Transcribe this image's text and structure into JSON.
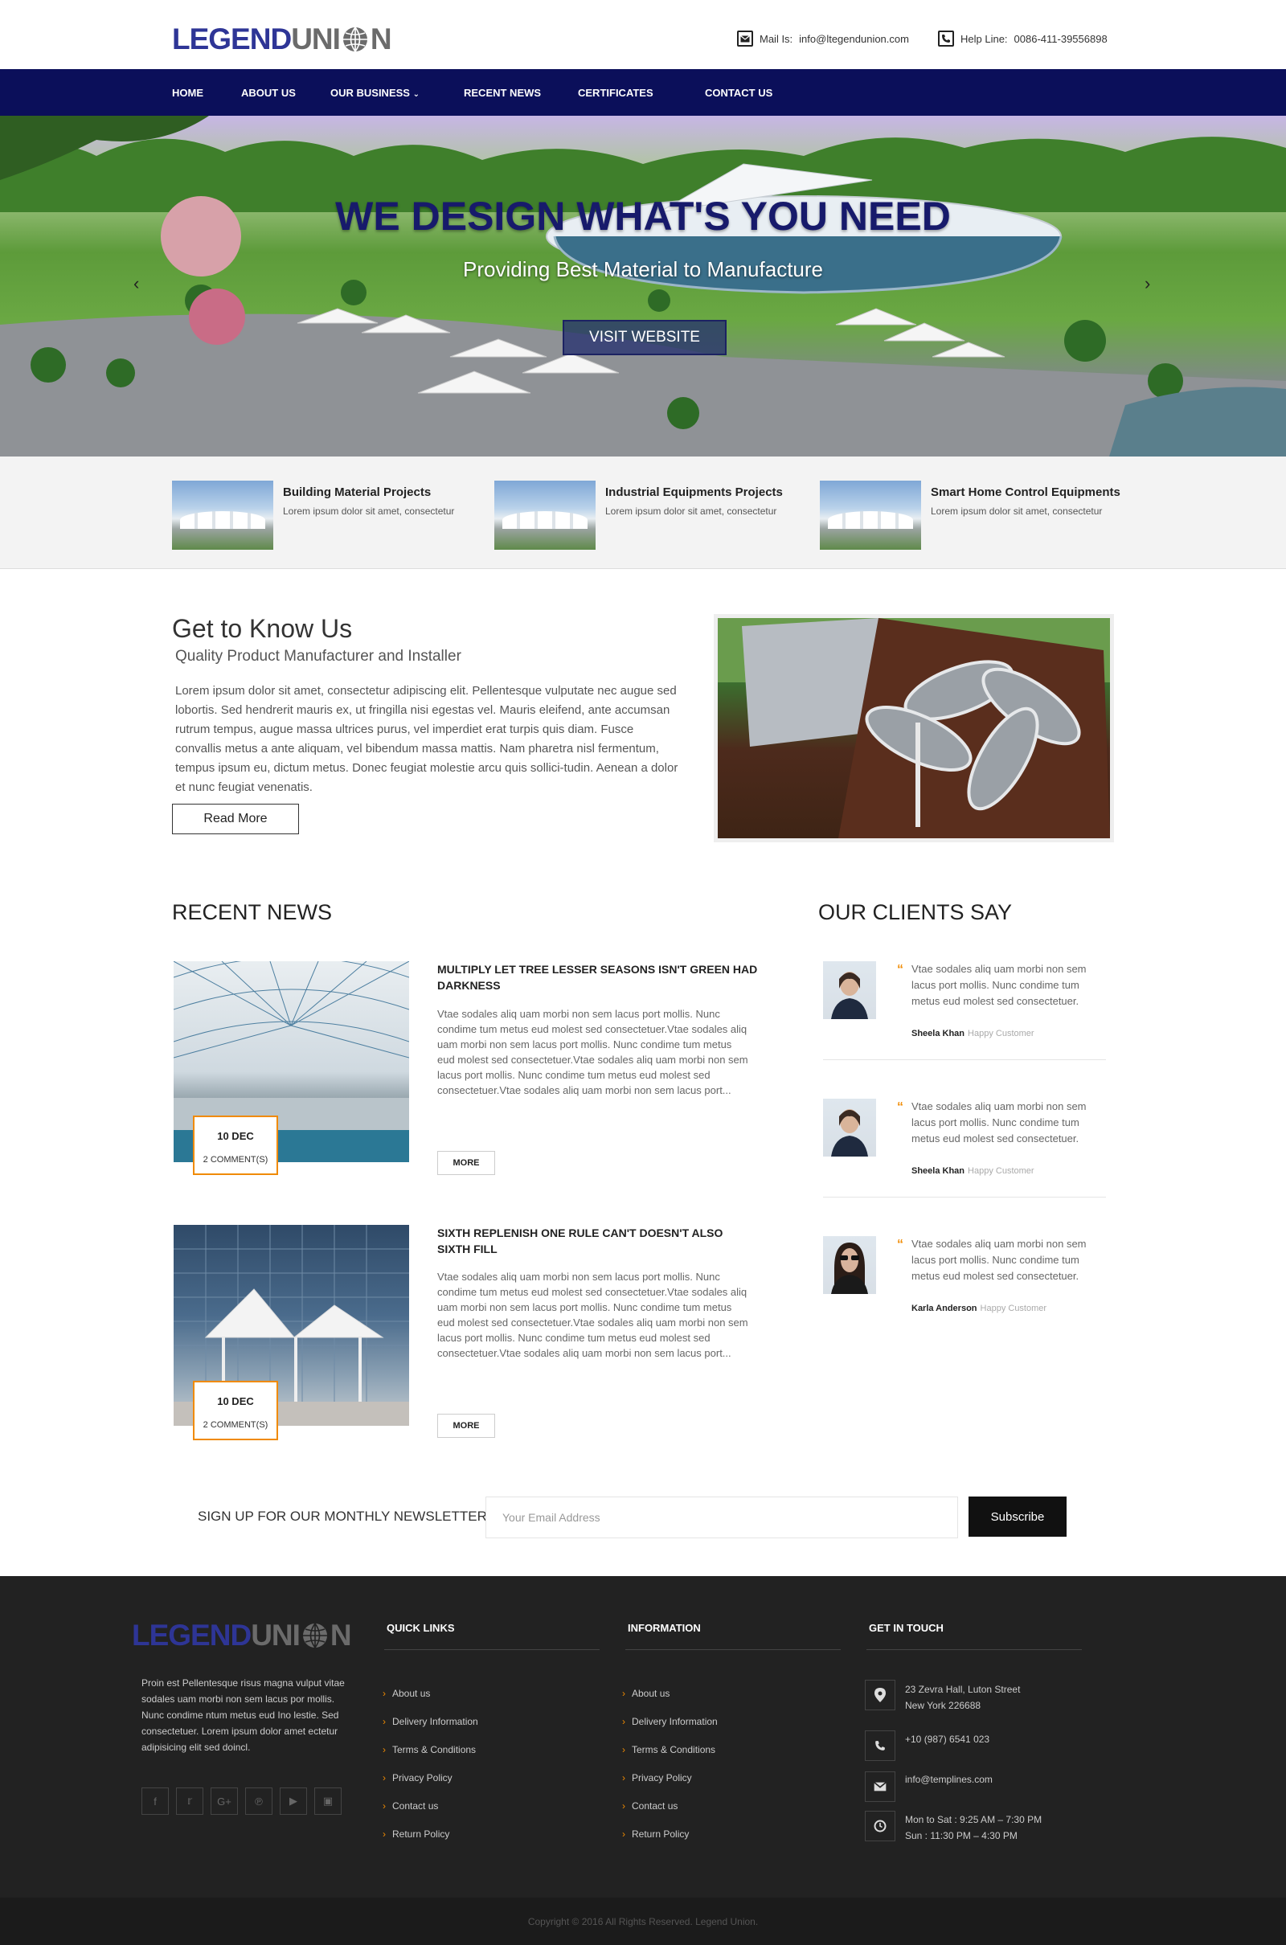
{
  "header": {
    "logo_part1": "LEGEND",
    "logo_part2": "UNI",
    "logo_part3": "N",
    "mail_label": "Mail Is:",
    "mail_value": "info@ltegendunion.com",
    "help_label": "Help Line:",
    "help_value": "0086-411-39556898"
  },
  "nav": {
    "items": [
      "HOME",
      "ABOUT US",
      "OUR BUSINESS",
      "RECENT NEWS",
      "CERTIFICATES",
      "CONTACT US"
    ]
  },
  "hero": {
    "title": "WE DESIGN WHAT'S YOU NEED",
    "subtitle": "Providing Best Material to Manufacture",
    "button": "VISIT WEBSITE"
  },
  "features": [
    {
      "title": "Building Material Projects",
      "text": "Lorem ipsum dolor sit amet, consectetur"
    },
    {
      "title": "Industrial Equipments Projects",
      "text": "Lorem ipsum dolor sit amet, consectetur"
    },
    {
      "title": "Smart Home Control Equipments",
      "text": "Lorem ipsum dolor sit amet, consectetur"
    }
  ],
  "about": {
    "title": "Get to Know Us",
    "subtitle": "Quality Product Manufacturer and Installer",
    "text": "Lorem ipsum dolor sit amet, consectetur adipiscing elit. Pellentesque vulputate nec augue sed lobortis. Sed hendrerit mauris ex, ut fringilla nisi egestas vel. Mauris eleifend, ante accumsan rutrum tempus, augue massa ultrices purus, vel imperdiet erat turpis quis diam. Fusce convallis metus a ante aliquam, vel bibendum massa mattis. Nam pharetra nisl fermentum, tempus ipsum eu, dictum metus. Donec feugiat molestie arcu quis sollici-tudin. Aenean a dolor et nunc feugiat venenatis.",
    "button": "Read More"
  },
  "news": {
    "title": "RECENT NEWS",
    "items": [
      {
        "date": "10 DEC",
        "comments": "2 COMMENT(S)",
        "headline": "MULTIPLY LET TREE LESSER SEASONS ISN'T GREEN HAD DARKNESS",
        "text": "Vtae sodales aliq uam morbi non sem lacus port mollis. Nunc condime tum metus eud molest sed consectetuer.Vtae sodales aliq uam morbi non sem lacus port mollis. Nunc condime tum metus eud molest sed consectetuer.Vtae sodales aliq uam morbi non sem lacus port mollis. Nunc condime tum metus eud molest sed consectetuer.Vtae sodales aliq uam morbi non sem lacus port...",
        "more": "MORE"
      },
      {
        "date": "10 DEC",
        "comments": "2 COMMENT(S)",
        "headline": "SIXTH REPLENISH ONE RULE CAN'T DOESN'T ALSO SIXTH FILL",
        "text": "Vtae sodales aliq uam morbi non sem lacus port mollis. Nunc condime tum metus eud molest sed consectetuer.Vtae sodales aliq uam morbi non sem lacus port mollis. Nunc condime tum metus eud molest sed consectetuer.Vtae sodales aliq uam morbi non sem lacus port mollis. Nunc condime tum metus eud molest sed consectetuer.Vtae sodales aliq uam morbi non sem lacus port...",
        "more": "MORE"
      }
    ]
  },
  "clients": {
    "title": "OUR CLIENTS SAY",
    "items": [
      {
        "quote": "Vtae sodales aliq uam morbi non sem lacus port mollis. Nunc condime tum metus eud molest sed consectetuer.",
        "name": "Sheela Khan",
        "role": "Happy Customer"
      },
      {
        "quote": "Vtae sodales aliq uam morbi non sem lacus port mollis. Nunc condime tum metus eud molest sed consectetuer.",
        "name": "Sheela Khan",
        "role": "Happy Customer"
      },
      {
        "quote": "Vtae sodales aliq uam morbi non sem lacus port mollis. Nunc condime tum metus eud molest sed consectetuer.",
        "name": "Karla Anderson",
        "role": "Happy Customer"
      }
    ]
  },
  "newsletter": {
    "label": "SIGN UP FOR OUR MONTHLY NEWSLETTER",
    "placeholder": "Your Email Address",
    "button": "Subscribe"
  },
  "footer": {
    "about": "Proin est Pellentesque risus magna vulput vitae sodales uam morbi non sem lacus por mollis. Nunc condime ntum metus eud Ino lestie. Sed consectetuer. Lorem ipsum dolor amet ectetur adipisicing elit sed doincl.",
    "quick_links_title": "QUICK LINKS",
    "quick_links": [
      "About us",
      "Delivery Information",
      "Terms & Conditions",
      "Privacy Policy",
      "Contact us",
      "Return Policy"
    ],
    "information_title": "INFORMATION",
    "information": [
      "About us",
      "Delivery Information",
      "Terms & Conditions",
      "Privacy Policy",
      "Contact us",
      "Return Policy"
    ],
    "touch_title": "GET IN TOUCH",
    "address_line1": "23 Zevra Hall, Luton Street",
    "address_line2": "New York 226688",
    "phone": "+10 (987) 6541 023",
    "email": "info@templines.com",
    "hours_line1": "Mon to Sat : 9:25 AM – 7:30 PM",
    "hours_line2": "Sun : 11:30 PM – 4:30 PM",
    "copyright": "Copyright © 2016 All Rights Reserved. Legend Union."
  },
  "icons": {
    "mail": "envelope-icon",
    "phone": "phone-icon",
    "social": [
      "facebook-icon",
      "twitter-icon",
      "google-plus-icon",
      "pinterest-icon",
      "youtube-icon",
      "instagram-icon"
    ],
    "location": "map-pin-icon",
    "clock": "clock-icon"
  },
  "colors": {
    "brand_blue": "#2e3596",
    "nav_bg": "#0b0f5a",
    "accent_orange": "#f08a00",
    "footer_bg": "#222222"
  }
}
